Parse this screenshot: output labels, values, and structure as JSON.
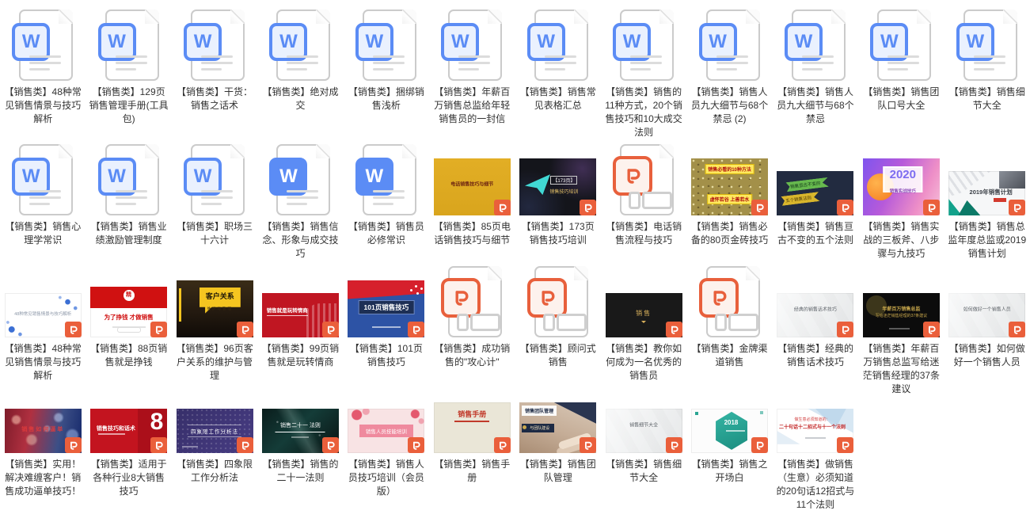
{
  "page": {
    "background": "#ffffff",
    "label_text_color": "#323232"
  },
  "colors": {
    "word_blue": "#5b8cf5",
    "word_badge_fill": "#eaf1fe",
    "ppt_orange": "#e8603c",
    "ppt_badge_orange": "#ea5f3b",
    "icon_page_border": "#cbcbcb"
  },
  "grid": {
    "columns": 12,
    "rows": 4,
    "total_items": 46
  },
  "items": [
    {
      "row": 1,
      "type": "word",
      "label": "【销售类】48种常见销售情景与技巧解析"
    },
    {
      "row": 1,
      "type": "word",
      "label": "【销售类】129页销售管理手册(工具包)"
    },
    {
      "row": 1,
      "type": "word",
      "label": "【销售类】干货：销售之话术"
    },
    {
      "row": 1,
      "type": "word",
      "label": "【销售类】绝对成交"
    },
    {
      "row": 1,
      "type": "word",
      "label": "【销售类】捆绑销售浅析"
    },
    {
      "row": 1,
      "type": "word",
      "label": "【销售类】年薪百万销售总监给年轻销售员的一封信"
    },
    {
      "row": 1,
      "type": "word",
      "label": "【销售类】销售常见表格汇总"
    },
    {
      "row": 1,
      "type": "word",
      "label": "【销售类】销售的11种方式，20个销售技巧和10大成交法则"
    },
    {
      "row": 1,
      "type": "word",
      "label": "【销售类】销售人员九大细节与68个禁忌 (2)"
    },
    {
      "row": 1,
      "type": "word",
      "label": "【销售类】销售人员九大细节与68个禁忌"
    },
    {
      "row": 1,
      "type": "word",
      "label": "【销售类】销售团队口号大全"
    },
    {
      "row": 1,
      "type": "word",
      "label": "【销售类】销售细节大全"
    },
    {
      "row": 2,
      "type": "word",
      "label": "【销售类】销售心理学常识"
    },
    {
      "row": 2,
      "type": "word",
      "label": "【销售类】销售业绩激励管理制度"
    },
    {
      "row": 2,
      "type": "word",
      "label": "【销售类】职场三十六计"
    },
    {
      "row": 2,
      "type": "word-solid",
      "label": "【销售类】销售信念、形象与成交技巧"
    },
    {
      "row": 2,
      "type": "word-solid",
      "label": "【销售类】销售员必修常识"
    },
    {
      "row": 2,
      "type": "thumb",
      "style": "gold",
      "size": "tall",
      "label": "【销售类】85页电话销售技巧与细节",
      "thumb_text": [
        "电话销售技巧与细节"
      ]
    },
    {
      "row": 2,
      "type": "thumb",
      "style": "space",
      "size": "tall",
      "label": "【销售类】173页销售技巧培训",
      "thumb_text": [
        "【173页】",
        "销售技巧培训"
      ]
    },
    {
      "row": 2,
      "type": "ppt-file",
      "label": "【销售类】电话销售流程与技巧"
    },
    {
      "row": 2,
      "type": "thumb",
      "style": "brick",
      "size": "tall",
      "label": "【销售类】销售必备的80页金砖技巧",
      "thumb_text": [
        "销售必看的10种方法",
        "虚怀若谷 上善若水"
      ]
    },
    {
      "row": 2,
      "type": "thumb",
      "style": "navy",
      "size": "wide",
      "label": "【销售类】销售亘古不变的五个法则",
      "thumb_text": [
        "销售亘古不变的",
        "五个销售法则"
      ]
    },
    {
      "row": 2,
      "type": "thumb",
      "style": "2020",
      "size": "tall",
      "label": "【销售类】销售实战的三板斧、八步骤与九技巧",
      "thumb_text": [
        "2020",
        "销售实战技巧"
      ]
    },
    {
      "row": 2,
      "type": "thumb",
      "style": "2019",
      "size": "wide",
      "label": "【销售类】销售总监年度总监或2019销售计划",
      "thumb_text": [
        "2019年销售计划"
      ]
    },
    {
      "row": 3,
      "type": "thumb",
      "style": "dots",
      "size": "wide",
      "label": "【销售类】48种常见销售情景与技巧解析",
      "thumb_text": [
        "48种常见销售情景与技巧解析"
      ]
    },
    {
      "row": 3,
      "type": "thumb",
      "style": "zq",
      "size": "mid",
      "label": "【销售类】88页销售就是挣钱",
      "thumb_text": [
        "精",
        "为了挣钱 才做销售"
      ]
    },
    {
      "row": 3,
      "type": "thumb",
      "style": "kehu",
      "size": "tall",
      "label": "【销售类】96页客户关系的维护与管理",
      "thumb_text": [
        "客户关系",
        "维护与管理"
      ]
    },
    {
      "row": 3,
      "type": "thumb",
      "style": "qs",
      "size": "wide",
      "label": "【销售类】99页销售就是玩转情商",
      "thumb_text": [
        "销售就是玩转情商"
      ]
    },
    {
      "row": 3,
      "type": "thumb",
      "style": "101",
      "size": "tall",
      "label": "【销售类】101页销售技巧",
      "thumb_text": [
        "101页销售技巧"
      ]
    },
    {
      "row": 3,
      "type": "ppt-file",
      "label": "【销售类】成功销售的\"攻心计\""
    },
    {
      "row": 3,
      "type": "ppt-file",
      "label": "【销售类】顾问式销售"
    },
    {
      "row": 3,
      "type": "thumb",
      "style": "bx",
      "size": "wide",
      "label": "【销售类】教你如何成为一名优秀的销售员",
      "thumb_text": [
        "销售"
      ]
    },
    {
      "row": 3,
      "type": "ppt-file",
      "label": "【销售类】金牌渠道销售"
    },
    {
      "row": 3,
      "type": "thumb",
      "style": "g1",
      "size": "wide",
      "label": "【销售类】经典的销售话术技巧",
      "thumb_text": [
        "经典的销售话术技巧"
      ]
    },
    {
      "row": 3,
      "type": "thumb",
      "style": "b37",
      "size": "wide",
      "label": "【销售类】年薪百万销售总监写给迷茫销售经理的37条建议",
      "thumb_text": [
        "年薪百万销售总监",
        "写给迷茫销售经理的37条建议"
      ]
    },
    {
      "row": 3,
      "type": "thumb",
      "style": "g2",
      "size": "wide",
      "label": "【销售类】如何做好一个销售人员",
      "thumb_text": [
        "如何做好一个销售人员"
      ]
    },
    {
      "row": 4,
      "type": "thumb",
      "style": "bokeh",
      "size": "wide",
      "label": "【销售类】实用！解决难缠客户！销售成功逼单技巧！",
      "thumb_text": [
        "销售如何逼单"
      ]
    },
    {
      "row": 4,
      "type": "thumb",
      "style": "red8",
      "size": "wide",
      "label": "【销售类】适用于各种行业8大销售技巧",
      "thumb_text": [
        "销售技巧和话术",
        "8"
      ]
    },
    {
      "row": 4,
      "type": "thumb",
      "style": "quad",
      "size": "wide",
      "label": "【销售类】四象限工作分析法",
      "thumb_text": [
        "四象限工作分析法"
      ]
    },
    {
      "row": 4,
      "type": "thumb",
      "style": "21",
      "size": "wide",
      "label": "【销售类】销售的二十一法则",
      "thumb_text": [
        "销售二十一 法则"
      ]
    },
    {
      "row": 4,
      "type": "thumb",
      "style": "pink",
      "size": "wide",
      "label": "【销售类】销售人员技巧培训（会员版）",
      "thumb_text": [
        "销售人员技能培训"
      ]
    },
    {
      "row": 4,
      "type": "thumb",
      "style": "man",
      "size": "mid",
      "label": "【销售类】销售手册",
      "thumb_text": [
        "销售手册"
      ]
    },
    {
      "row": 4,
      "type": "thumb",
      "style": "hands",
      "size": "mid",
      "label": "【销售类】销售团队管理",
      "thumb_text": [
        "销售团队管理",
        "与团队建设"
      ]
    },
    {
      "row": 4,
      "type": "thumb",
      "style": "g3",
      "size": "wide",
      "label": "【销售类】销售细节大全",
      "thumb_text": [
        "销售细节大全"
      ]
    },
    {
      "row": 4,
      "type": "thumb",
      "style": "2018",
      "size": "wide",
      "label": "【销售类】销售之开场白",
      "thumb_text": [
        "2018"
      ]
    },
    {
      "row": 4,
      "type": "thumb",
      "style": "20ju",
      "size": "wide",
      "label": "【销售类】做销售（生意）必须知道的20句话12招式与11个法则",
      "thumb_text": [
        "做生意必须知道的：",
        "二十句话十二招式与十一个法则"
      ]
    }
  ]
}
